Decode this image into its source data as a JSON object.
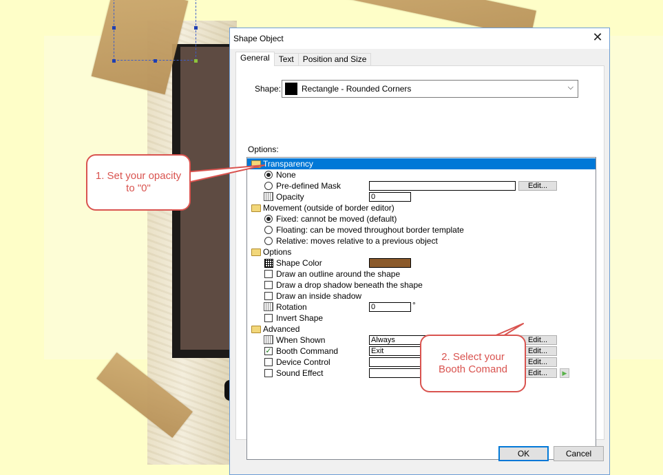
{
  "dialog": {
    "title": "Shape Object",
    "close_glyph": "✕",
    "tabs": [
      {
        "label": "General",
        "active": true
      },
      {
        "label": "Text",
        "active": false
      },
      {
        "label": "Position and Size",
        "active": false
      }
    ],
    "shape_label": "Shape:",
    "shape_value": "Rectangle - Rounded Corners",
    "options_label": "Options:",
    "ok_label": "OK",
    "cancel_label": "Cancel"
  },
  "options": {
    "transparency": {
      "heading": "Transparency",
      "none": "None",
      "predefined_mask": "Pre-defined Mask",
      "predefined_mask_value": "",
      "opacity": "Opacity",
      "opacity_value": "0",
      "edit": "Edit..."
    },
    "movement": {
      "heading": "Movement  (outside of border editor)",
      "fixed": "Fixed:  cannot be moved (default)",
      "floating": "Floating:  can be moved throughout border template",
      "relative": "Relative:  moves relative to a previous object"
    },
    "opts": {
      "heading": "Options",
      "shape_color": "Shape Color",
      "shape_color_hex": "#8b5a2b",
      "outline": "Draw an outline around the shape",
      "drop_shadow": "Draw a drop shadow beneath the shape",
      "inside_shadow": "Draw an inside shadow",
      "rotation": "Rotation",
      "rotation_value": "0",
      "degree": "°",
      "invert": "Invert Shape"
    },
    "advanced": {
      "heading": "Advanced",
      "when_shown": "When Shown",
      "when_shown_value": "Always",
      "booth_command": "Booth Command",
      "booth_command_value": "Exit",
      "device_control": "Device Control",
      "device_control_value": "",
      "sound_effect": "Sound Effect",
      "sound_effect_value": "",
      "edit": "Edit...",
      "play_glyph": "▶"
    }
  },
  "callouts": {
    "one": "1. Set your opacity to \"0\"",
    "two": "2. Select your Booth Comand"
  },
  "colors": {
    "accent_selection": "#0078d7",
    "callout_red": "#d9534f",
    "background": "#fefec8"
  }
}
